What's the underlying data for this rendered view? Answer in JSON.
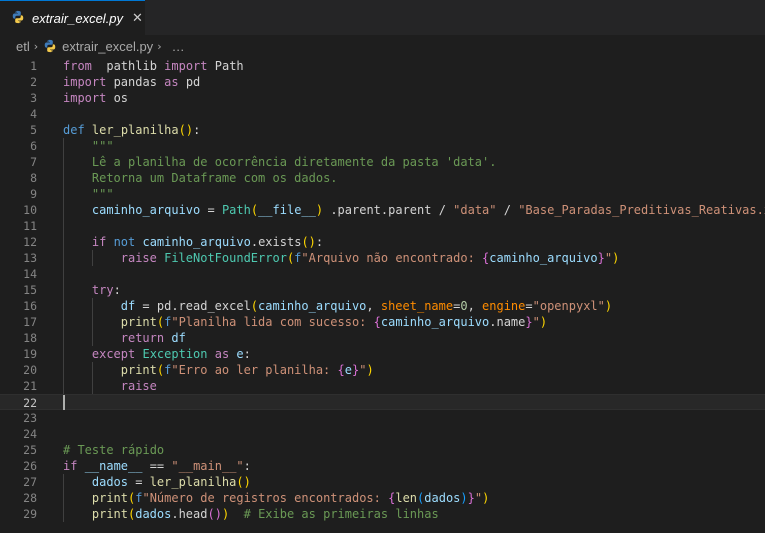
{
  "tab": {
    "filename": "extrair_excel.py",
    "close_glyph": "✕"
  },
  "breadcrumb": {
    "folder": "etl",
    "separator": "›",
    "file": "extrair_excel.py",
    "more": "…"
  },
  "editor": {
    "current_line": 22,
    "lines": [
      {
        "n": "1",
        "indent": 0,
        "tokens": [
          [
            "kc",
            "from"
          ],
          [
            "",
            "  pathlib "
          ],
          [
            "kc",
            "import"
          ],
          [
            "",
            " Path"
          ]
        ]
      },
      {
        "n": "2",
        "indent": 0,
        "tokens": [
          [
            "kc",
            "import"
          ],
          [
            "",
            " pandas "
          ],
          [
            "kc",
            "as"
          ],
          [
            "",
            " pd"
          ]
        ]
      },
      {
        "n": "3",
        "indent": 0,
        "tokens": [
          [
            "kc",
            "import"
          ],
          [
            "",
            " os"
          ]
        ]
      },
      {
        "n": "4",
        "indent": 0,
        "tokens": []
      },
      {
        "n": "5",
        "indent": 0,
        "tokens": [
          [
            "k",
            "def"
          ],
          [
            "",
            " "
          ],
          [
            "f",
            "ler_planilha"
          ],
          [
            "br1",
            "()"
          ],
          [
            ":",
            ":"
          ]
        ]
      },
      {
        "n": "6",
        "indent": 1,
        "tokens": [
          [
            "c",
            "\"\"\""
          ]
        ]
      },
      {
        "n": "7",
        "indent": 1,
        "tokens": [
          [
            "c",
            "Lê a planilha de ocorrência diretamente da pasta 'data'."
          ]
        ]
      },
      {
        "n": "8",
        "indent": 1,
        "tokens": [
          [
            "c",
            "Retorna um Dataframe com os dados."
          ]
        ]
      },
      {
        "n": "9",
        "indent": 1,
        "tokens": [
          [
            "c",
            "\"\"\""
          ]
        ]
      },
      {
        "n": "10",
        "indent": 1,
        "tokens": [
          [
            "p",
            "caminho_arquivo"
          ],
          [
            "",
            " = "
          ],
          [
            "cls",
            "Path"
          ],
          [
            "br1",
            "("
          ],
          [
            "p",
            "__file__"
          ],
          [
            "br1",
            ")"
          ],
          [
            "",
            " .parent.parent / "
          ],
          [
            "s",
            "\"data\""
          ],
          [
            "",
            " / "
          ],
          [
            "s",
            "\"Base_Paradas_Preditivas_Reativas.xlsx\""
          ]
        ]
      },
      {
        "n": "11",
        "indent": 1,
        "tokens": []
      },
      {
        "n": "12",
        "indent": 1,
        "tokens": [
          [
            "kc",
            "if"
          ],
          [
            "",
            " "
          ],
          [
            "k",
            "not"
          ],
          [
            "",
            " "
          ],
          [
            "p",
            "caminho_arquivo"
          ],
          [
            "",
            ".exists"
          ],
          [
            "br1",
            "()"
          ],
          [
            "",
            ":"
          ]
        ]
      },
      {
        "n": "13",
        "indent": 2,
        "tokens": [
          [
            "kc",
            "raise"
          ],
          [
            "",
            " "
          ],
          [
            "cls",
            "FileNotFoundError"
          ],
          [
            "br1",
            "("
          ],
          [
            "k",
            "f"
          ],
          [
            "s",
            "\"Arquivo não encontrado: "
          ],
          [
            "br2",
            "{"
          ],
          [
            "p",
            "caminho_arquivo"
          ],
          [
            "br2",
            "}"
          ],
          [
            "s",
            "\""
          ],
          [
            "br1",
            ")"
          ]
        ]
      },
      {
        "n": "14",
        "indent": 1,
        "tokens": []
      },
      {
        "n": "15",
        "indent": 1,
        "tokens": [
          [
            "kc",
            "try"
          ],
          [
            "",
            ":"
          ]
        ]
      },
      {
        "n": "16",
        "indent": 2,
        "tokens": [
          [
            "p",
            "df"
          ],
          [
            "",
            " = pd.read_excel"
          ],
          [
            "br1",
            "("
          ],
          [
            "p",
            "caminho_arquivo"
          ],
          [
            "",
            ", "
          ],
          [
            "sp",
            "sheet_name"
          ],
          [
            "",
            "="
          ],
          [
            "n",
            "0"
          ],
          [
            "",
            ", "
          ],
          [
            "sp",
            "engine"
          ],
          [
            "",
            "="
          ],
          [
            "s",
            "\"openpyxl\""
          ],
          [
            "br1",
            ")"
          ]
        ]
      },
      {
        "n": "17",
        "indent": 2,
        "tokens": [
          [
            "f",
            "print"
          ],
          [
            "br1",
            "("
          ],
          [
            "k",
            "f"
          ],
          [
            "s",
            "\"Planilha lida com sucesso: "
          ],
          [
            "br2",
            "{"
          ],
          [
            "p",
            "caminho_arquivo"
          ],
          [
            "",
            ".name"
          ],
          [
            "br2",
            "}"
          ],
          [
            "s",
            "\""
          ],
          [
            "br1",
            ")"
          ]
        ]
      },
      {
        "n": "18",
        "indent": 2,
        "tokens": [
          [
            "kc",
            "return"
          ],
          [
            "",
            " "
          ],
          [
            "p",
            "df"
          ]
        ]
      },
      {
        "n": "19",
        "indent": 1,
        "tokens": [
          [
            "kc",
            "except"
          ],
          [
            "",
            " "
          ],
          [
            "cls",
            "Exception"
          ],
          [
            "",
            " "
          ],
          [
            "kc",
            "as"
          ],
          [
            "",
            " "
          ],
          [
            "p",
            "e"
          ],
          [
            "",
            ":"
          ]
        ]
      },
      {
        "n": "20",
        "indent": 2,
        "tokens": [
          [
            "f",
            "print"
          ],
          [
            "br1",
            "("
          ],
          [
            "k",
            "f"
          ],
          [
            "s",
            "\"Erro ao ler planilha: "
          ],
          [
            "br2",
            "{"
          ],
          [
            "p",
            "e"
          ],
          [
            "br2",
            "}"
          ],
          [
            "s",
            "\""
          ],
          [
            "br1",
            ")"
          ]
        ]
      },
      {
        "n": "21",
        "indent": 2,
        "tokens": [
          [
            "kc",
            "raise"
          ]
        ]
      },
      {
        "n": "22",
        "indent": 0,
        "tokens": []
      },
      {
        "n": "23",
        "indent": 0,
        "tokens": []
      },
      {
        "n": "24",
        "indent": 0,
        "tokens": []
      },
      {
        "n": "25",
        "indent": 0,
        "tokens": [
          [
            "c",
            "# Teste rápido"
          ]
        ]
      },
      {
        "n": "26",
        "indent": 0,
        "tokens": [
          [
            "kc",
            "if"
          ],
          [
            "",
            " "
          ],
          [
            "p",
            "__name__"
          ],
          [
            "",
            " == "
          ],
          [
            "s",
            "\"__main__\""
          ],
          [
            "",
            ":"
          ]
        ]
      },
      {
        "n": "27",
        "indent": 1,
        "tokens": [
          [
            "p",
            "dados"
          ],
          [
            "",
            " = "
          ],
          [
            "f",
            "ler_planilha"
          ],
          [
            "br1",
            "()"
          ]
        ]
      },
      {
        "n": "28",
        "indent": 1,
        "tokens": [
          [
            "f",
            "print"
          ],
          [
            "br1",
            "("
          ],
          [
            "k",
            "f"
          ],
          [
            "s",
            "\"Número de registros encontrados: "
          ],
          [
            "br2",
            "{"
          ],
          [
            "f",
            "len"
          ],
          [
            "br3",
            "("
          ],
          [
            "p",
            "dados"
          ],
          [
            "br3",
            ")"
          ],
          [
            "br2",
            "}"
          ],
          [
            "s",
            "\""
          ],
          [
            "br1",
            ")"
          ]
        ]
      },
      {
        "n": "29",
        "indent": 1,
        "tokens": [
          [
            "f",
            "print"
          ],
          [
            "br1",
            "("
          ],
          [
            "p",
            "dados"
          ],
          [
            "",
            ".head"
          ],
          [
            "br2",
            "()"
          ],
          [
            "br1",
            ")"
          ],
          [
            "",
            "  "
          ],
          [
            "c",
            "# Exibe as primeiras linhas"
          ]
        ]
      }
    ]
  },
  "colors": {
    "accent": "#0078d4",
    "background": "#1e1e1e",
    "tabbar": "#252526"
  },
  "icons": {
    "file_icon": "python-icon"
  }
}
